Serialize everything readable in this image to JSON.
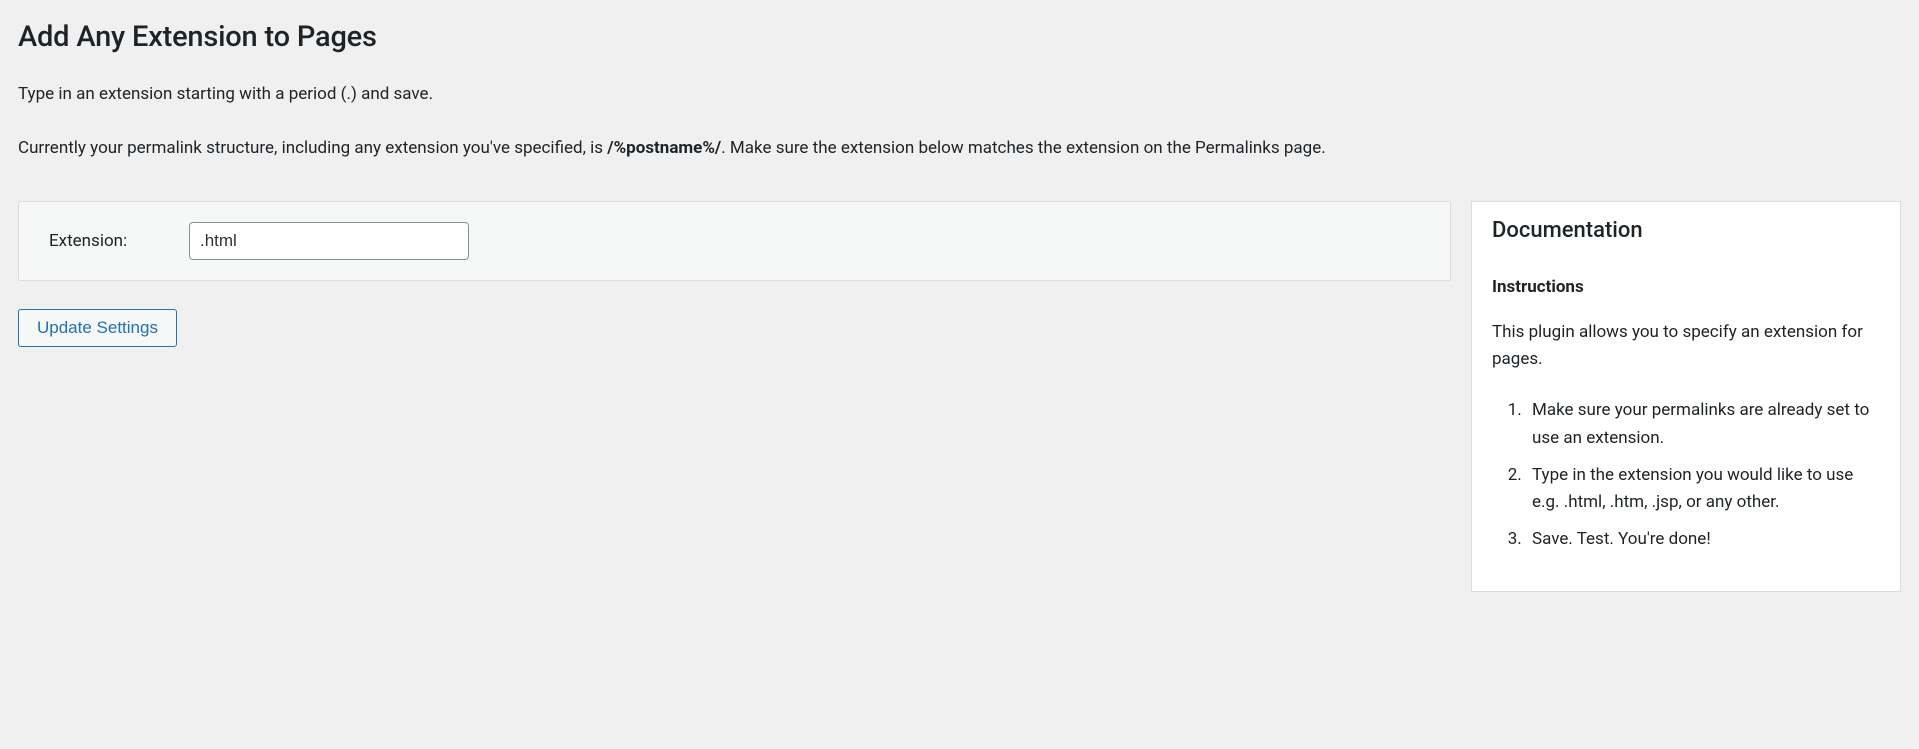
{
  "header": {
    "title": "Add Any Extension to Pages"
  },
  "intro": {
    "line1": "Type in an extension starting with a period (.) and save.",
    "line2_prefix": "Currently your permalink structure, including any extension you've specified, is ",
    "permalink_structure": "/%postname%/",
    "line2_suffix": ". Make sure the extension below matches the extension on the Permalinks page."
  },
  "form": {
    "label": "Extension:",
    "extension_value": ".html",
    "submit_label": "Update Settings"
  },
  "documentation": {
    "title": "Documentation",
    "subtitle": "Instructions",
    "description": "This plugin allows you to specify an extension for pages.",
    "steps": [
      "Make sure your permalinks are already set to use an extension.",
      "Type in the extension you would like to use e.g. .html, .htm, .jsp, or any other.",
      "Save. Test. You're done!"
    ]
  }
}
